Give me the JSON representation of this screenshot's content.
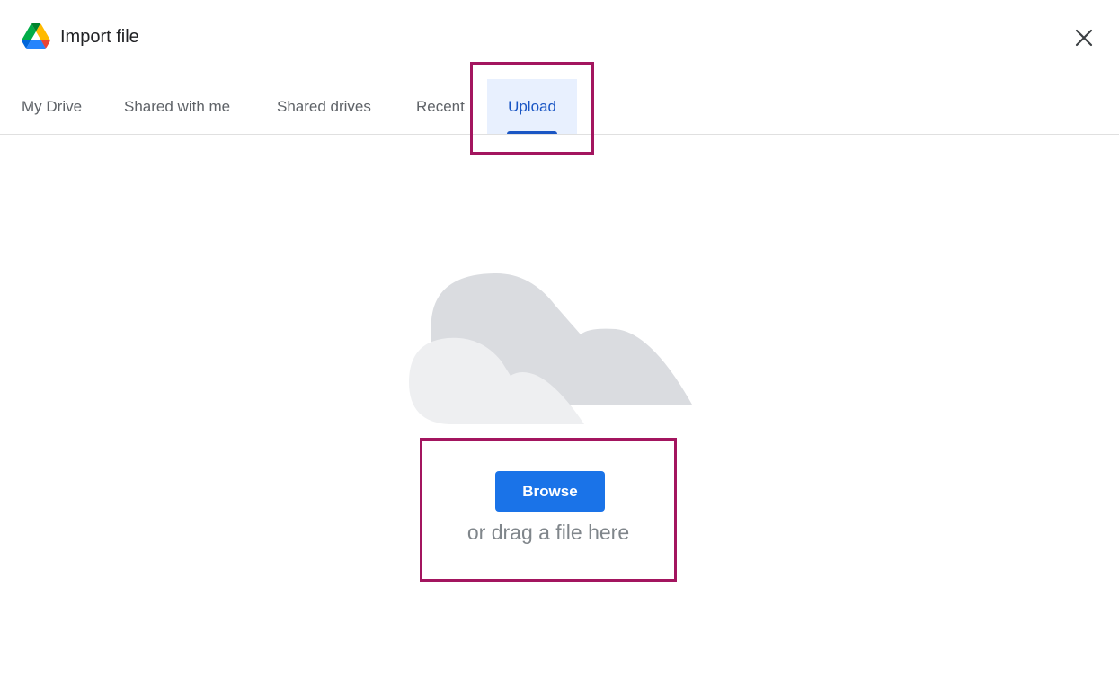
{
  "dialog": {
    "title": "Import file",
    "logo_icon": "google-drive-icon",
    "close_icon": "close-icon"
  },
  "tabs": [
    {
      "label": "My Drive",
      "selected": false
    },
    {
      "label": "Shared with me",
      "selected": false
    },
    {
      "label": "Shared drives",
      "selected": false
    },
    {
      "label": "Recent",
      "selected": false
    },
    {
      "label": "Upload",
      "selected": true
    }
  ],
  "upload": {
    "illustration_icon": "cloud-icon",
    "browse_label": "Browse",
    "drag_text": "or drag a file here"
  },
  "colors": {
    "accent": "#1a73e8",
    "tab_selected_text": "#1a56c4",
    "tab_selected_bg": "#e8f0fe",
    "highlight_border": "#a3155f"
  }
}
